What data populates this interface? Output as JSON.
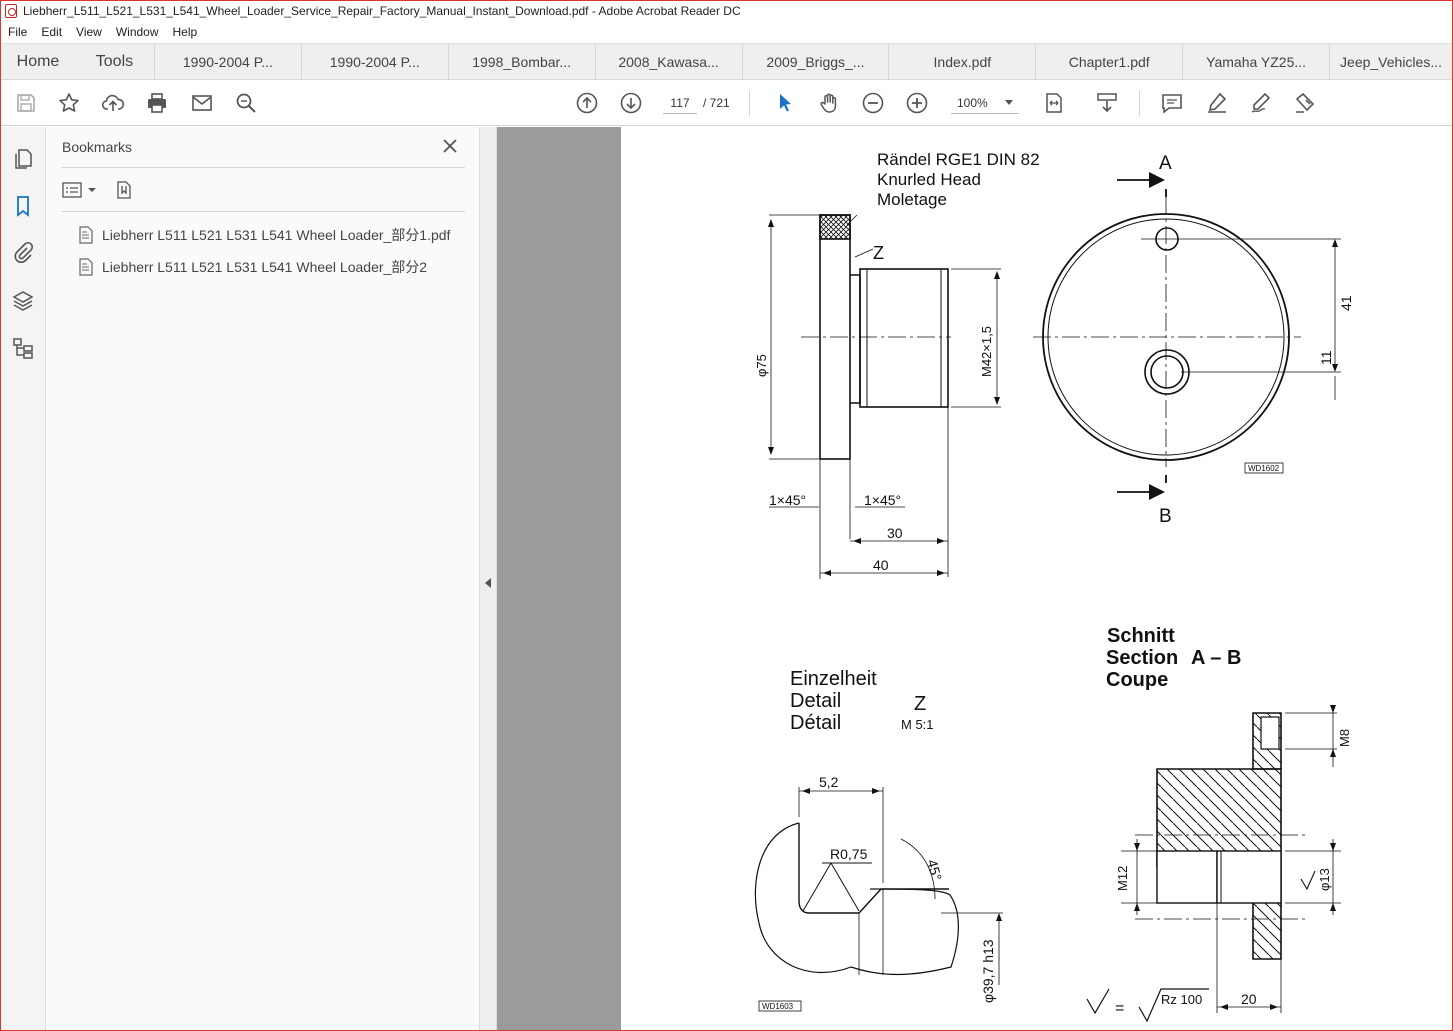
{
  "window": {
    "title": "Liebherr_L511_L521_L531_L541_Wheel_Loader_Service_Repair_Factory_Manual_Instant_Download.pdf - Adobe Acrobat Reader DC"
  },
  "menu": [
    "File",
    "Edit",
    "View",
    "Window",
    "Help"
  ],
  "tabs": {
    "home": "Home",
    "tools": "Tools",
    "docs": [
      "1990-2004 P...",
      "1990-2004 P...",
      "1998_Bombar...",
      "2008_Kawasa...",
      "2009_Briggs_...",
      "Index.pdf",
      "Chapter1.pdf",
      "Yamaha YZ25...",
      "Jeep_Vehicles..."
    ]
  },
  "toolbar": {
    "current_page": "117",
    "total_pages": "/ 721",
    "zoom": "100%",
    "icons": [
      "save-icon",
      "star-icon",
      "upload-icon",
      "print-icon",
      "mail-icon",
      "search-icon",
      "page-up-icon",
      "page-down-icon",
      "select-cursor-icon",
      "hand-icon",
      "zoom-out-icon",
      "zoom-in-icon",
      "fit-page-icon",
      "scroll-mode-icon",
      "comment-icon",
      "highlight-icon",
      "sign-icon",
      "fill-sign-icon"
    ]
  },
  "bookmarks": {
    "title": "Bookmarks",
    "items": [
      "Liebherr L511 L521 L531 L541 Wheel Loader_部分1.pdf",
      "Liebherr L511 L521 L531 L541 Wheel Loader_部分2"
    ]
  },
  "drawing": {
    "callout_1": "Rändel RGE1 DIN 82",
    "callout_2": "Knurled Head",
    "callout_3": "Moletage",
    "z_mark": "Z",
    "dim_phi75": "φ75",
    "dim_m42": "M42×1,5",
    "dim_chamfer_left": "1×45°",
    "dim_chamfer_right": "1×45°",
    "dim_30": "30",
    "dim_40": "40",
    "section_a": "A",
    "section_b": "B",
    "dim_41": "41",
    "dim_11": "11",
    "ref_1602": "WD1602",
    "detail_1": "Einzelheit",
    "detail_2": "Detail",
    "detail_3": "Détail",
    "detail_z": "Z",
    "detail_scale": "M 5:1",
    "dim_52": "5,2",
    "dim_r075": "R0,75",
    "dim_45": "45°",
    "dim_phi397": "φ39,7 h13",
    "ref_1603": "WD1603",
    "schnitt_1": "Schnitt",
    "schnitt_2": "Section",
    "schnitt_ab": "A – B",
    "schnitt_3": "Coupe",
    "dim_m8": "M8",
    "dim_m12": "M12",
    "dim_phi13": "φ13",
    "dim_20": "20",
    "surface_eq": "=",
    "surface_rz": "Rz 100"
  }
}
